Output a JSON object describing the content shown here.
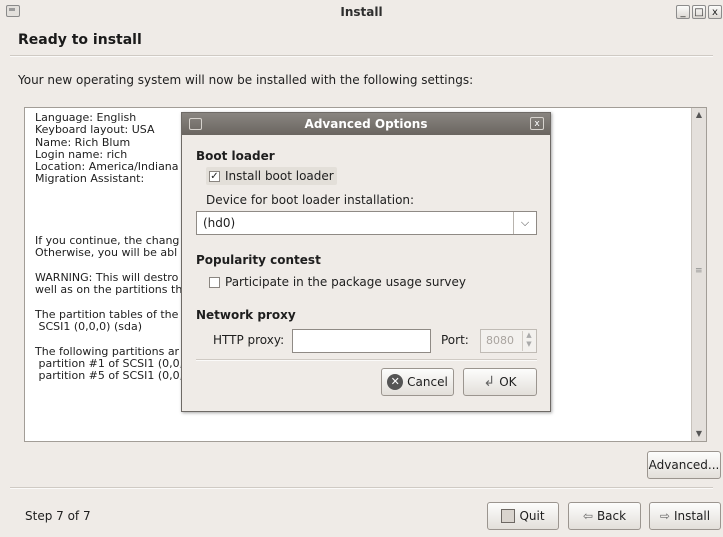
{
  "window": {
    "title": "Install",
    "icon": "installer-icon"
  },
  "window_controls": {
    "minimize": "_",
    "maximize": "□",
    "close": "x"
  },
  "header": {
    "heading": "Ready to install"
  },
  "intro_text": "Your new operating system will now be installed with the following settings:",
  "summary_lines": [
    "Language: English",
    "Keyboard layout: USA",
    "Name: Rich Blum",
    "Login name: rich",
    "Location: America/Indiana",
    "Migration Assistant:",
    "",
    "",
    "",
    "",
    "If you continue, the chang",
    "Otherwise, you will be abl",
    "",
    "WARNING: This will destro",
    "well as on the partitions th",
    "",
    "The partition tables of the",
    " SCSI1 (0,0,0) (sda)",
    "",
    "The following partitions ar",
    " partition #1 of SCSI1 (0,0,",
    " partition #5 of SCSI1 (0,0,0) (sda) as swap"
  ],
  "buttons": {
    "advanced": "Advanced...",
    "quit": "Quit",
    "back": "Back",
    "install": "Install"
  },
  "footer": {
    "step": "Step 7 of 7"
  },
  "dialog": {
    "title": "Advanced Options",
    "close_glyph": "x",
    "boot_loader": {
      "section": "Boot loader",
      "install_label": "Install boot loader",
      "install_checked": true,
      "device_label": "Device for boot loader installation:",
      "device_value": "(hd0)"
    },
    "popularity": {
      "section": "Popularity contest",
      "participate_label": "Participate in the package usage survey",
      "participate_checked": false
    },
    "network": {
      "section": "Network proxy",
      "http_label": "HTTP proxy:",
      "http_value": "",
      "port_label": "Port:",
      "port_value": "8080"
    },
    "cancel": "Cancel",
    "ok": "OK"
  },
  "colors": {
    "window_bg": "#efebe7",
    "dialog_title_bg": "#6a6560",
    "text": "#1e1e1e"
  }
}
